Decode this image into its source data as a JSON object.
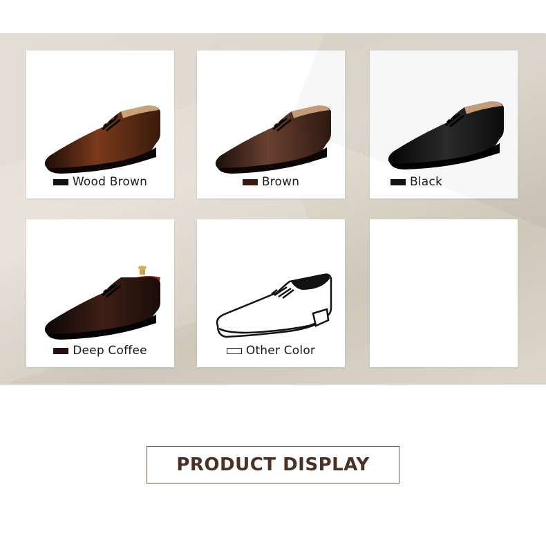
{
  "colors": {
    "band_background": "#d9d3c8",
    "title_text": "#4a3121",
    "title_border": "#6b5a4a"
  },
  "color_options": [
    {
      "label": "Wood Brown",
      "swatch": "#111111",
      "shoe_color": "#5e2a14",
      "icon": "oxford-shoe-icon"
    },
    {
      "label": "Brown",
      "swatch": "#3a1a10",
      "shoe_color": "#4a2a1e",
      "icon": "oxford-shoe-icon"
    },
    {
      "label": "Black",
      "swatch": "#111111",
      "shoe_color": "#161616",
      "icon": "oxford-shoe-icon"
    },
    {
      "label": "Deep Coffee",
      "swatch": "#2a0f0a",
      "shoe_color": "#2b1410",
      "icon": "oxford-shoe-icon"
    },
    {
      "label": "Other Color",
      "swatch": "#ffffff",
      "shoe_color": "#ffffff",
      "icon": "shoe-outline-icon"
    }
  ],
  "section_title": "PRODUCT DISPLAY"
}
